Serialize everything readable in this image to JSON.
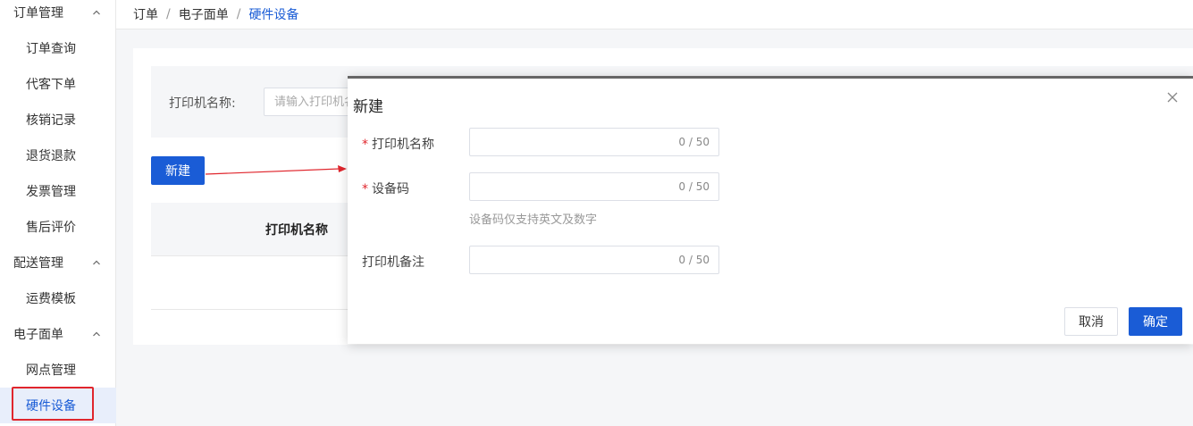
{
  "sidebar": {
    "groups": [
      {
        "label": "订单管理",
        "items": [
          "订单查询",
          "代客下单",
          "核销记录",
          "退货退款",
          "发票管理",
          "售后评价"
        ]
      },
      {
        "label": "配送管理",
        "items": [
          "运费模板"
        ]
      },
      {
        "label": "电子面单",
        "items": [
          "网点管理",
          "硬件设备"
        ]
      }
    ],
    "active_item": "硬件设备"
  },
  "breadcrumb": {
    "items": [
      "订单",
      "电子面单",
      "硬件设备"
    ],
    "separator": "/"
  },
  "search": {
    "label": "打印机名称:",
    "placeholder": "请输入打印机名称"
  },
  "toolbar": {
    "new_label": "新建"
  },
  "table": {
    "columns": [
      "打印机名称"
    ]
  },
  "modal": {
    "title": "新建",
    "fields": [
      {
        "label": "打印机名称",
        "required": true,
        "counter": "0 / 50"
      },
      {
        "label": "设备码",
        "required": true,
        "counter": "0 / 50",
        "hint": "设备码仅支持英文及数字"
      },
      {
        "label": "打印机备注",
        "required": false,
        "counter": "0 / 50"
      }
    ],
    "cancel_label": "取消",
    "ok_label": "确定"
  },
  "colors": {
    "primary": "#1a5cd6",
    "highlight": "#e0262d",
    "required_mark": "#e0262d"
  },
  "icons": {
    "group_chevron": "chevron-up-icon",
    "modal_close": "close-icon"
  }
}
